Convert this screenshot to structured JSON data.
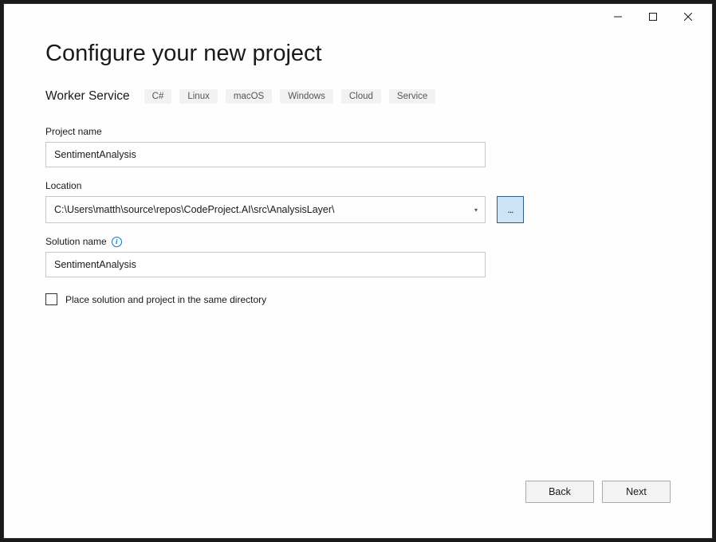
{
  "window": {
    "minimize_label": "Minimize",
    "maximize_label": "Maximize",
    "close_label": "Close"
  },
  "header": {
    "title": "Configure your new project",
    "template_name": "Worker Service",
    "tags": [
      "C#",
      "Linux",
      "macOS",
      "Windows",
      "Cloud",
      "Service"
    ]
  },
  "fields": {
    "project_name": {
      "label": "Project name",
      "value": "SentimentAnalysis"
    },
    "location": {
      "label": "Location",
      "value": "C:\\Users\\matth\\source\\repos\\CodeProject.AI\\src\\AnalysisLayer\\",
      "browse_label": "..."
    },
    "solution_name": {
      "label": "Solution name",
      "value": "SentimentAnalysis"
    },
    "same_directory": {
      "label": "Place solution and project in the same directory",
      "checked": false
    }
  },
  "footer": {
    "back_label": "Back",
    "next_label": "Next"
  }
}
